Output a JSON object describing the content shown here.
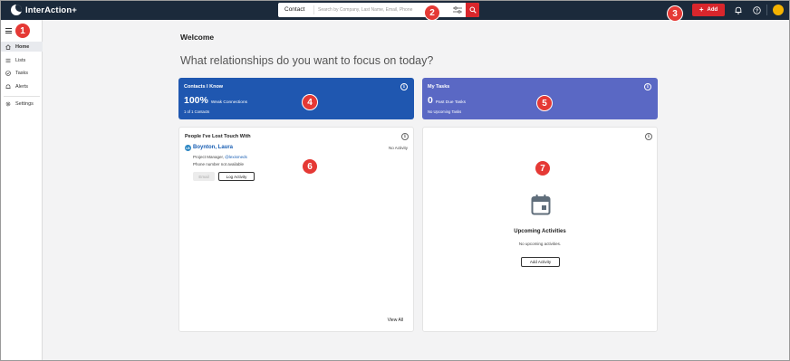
{
  "app": {
    "name": "InterAction+"
  },
  "search": {
    "scope": "Contact",
    "placeholder": "Search by Company, Last Name, Email, Phone"
  },
  "topbar": {
    "add_label": "Add"
  },
  "sidebar": {
    "items": [
      {
        "label": "Home",
        "icon": "home-icon",
        "active": true
      },
      {
        "label": "Lists",
        "icon": "list-icon"
      },
      {
        "label": "Tasks",
        "icon": "check-circle-icon"
      },
      {
        "label": "Alerts",
        "icon": "bell-icon"
      },
      {
        "label": "Settings",
        "icon": "gear-icon"
      }
    ]
  },
  "main": {
    "welcome": "Welcome",
    "headline": "What relationships do you want to focus on today?"
  },
  "contacts_card": {
    "title": "Contacts I Know",
    "value": "100%",
    "value_label": "Weak Connections",
    "sub": "1 of 1 Contacts",
    "color": "#1f57b0"
  },
  "tasks_card": {
    "title": "My Tasks",
    "value": "0",
    "value_label": "Past Due Tasks",
    "sub": "No Upcoming Tasks",
    "color": "#5a68c4"
  },
  "people_card": {
    "title": "People I've Lost Touch With",
    "person": {
      "initials": "LB",
      "name": "Boynton, Laura",
      "activity": "No Activity",
      "role": "Project Manager,",
      "company": "@lexismeds",
      "phone": "Phone number not available",
      "email_label": "Email",
      "log_label": "Log Activity"
    },
    "view_all": "View All"
  },
  "activities_card": {
    "title": "Upcoming Activities",
    "sub": "No upcoming activities.",
    "button": "Add Activity"
  },
  "markers": [
    "1",
    "2",
    "3",
    "4",
    "5",
    "6",
    "7"
  ],
  "colors": {
    "topbar": "#1b2a3b",
    "accent_red": "#d9262c",
    "link_blue": "#1a5fb4",
    "avatar": "#f5b301",
    "marker": "#e53935"
  }
}
